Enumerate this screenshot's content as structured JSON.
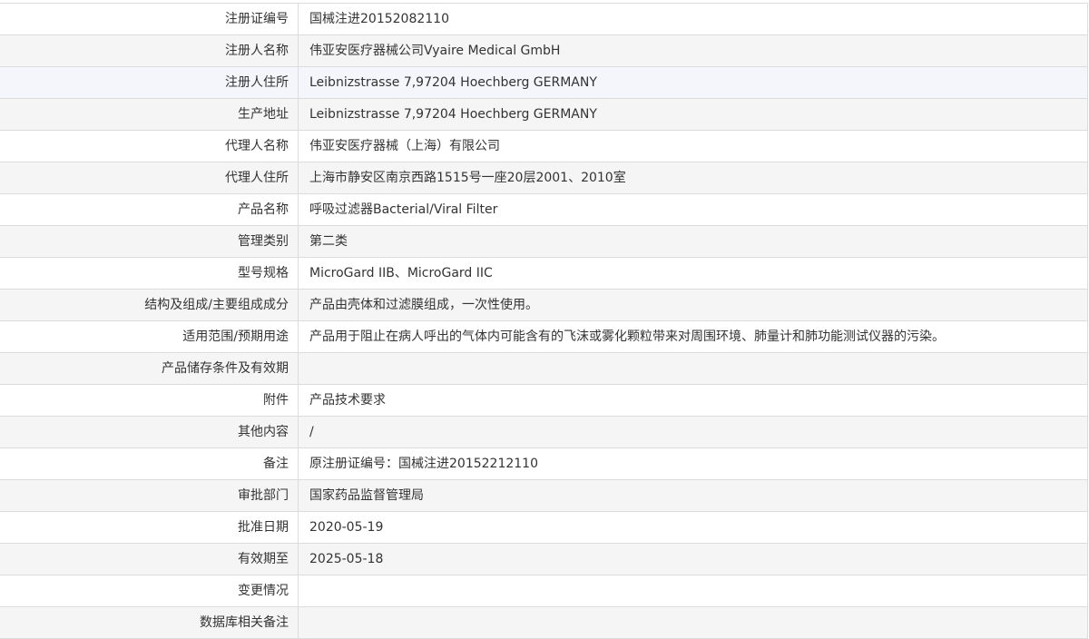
{
  "rows": [
    {
      "label": "注册证编号",
      "value": "国械注进20152082110"
    },
    {
      "label": "注册人名称",
      "value": "伟亚安医疗器械公司Vyaire Medical GmbH"
    },
    {
      "label": "注册人住所",
      "value": "Leibnizstrasse 7,97204 Hoechberg GERMANY"
    },
    {
      "label": "生产地址",
      "value": "Leibnizstrasse 7,97204 Hoechberg GERMANY"
    },
    {
      "label": "代理人名称",
      "value": "伟亚安医疗器械（上海）有限公司"
    },
    {
      "label": "代理人住所",
      "value": "上海市静安区南京西路1515号一座20层2001、2010室"
    },
    {
      "label": "产品名称",
      "value": "呼吸过滤器Bacterial/Viral Filter"
    },
    {
      "label": "管理类别",
      "value": "第二类"
    },
    {
      "label": "型号规格",
      "value": "MicroGard IIB、MicroGard IIC"
    },
    {
      "label": "结构及组成/主要组成成分",
      "value": "产品由壳体和过滤膜组成，一次性使用。"
    },
    {
      "label": "适用范围/预期用途",
      "value": "产品用于阻止在病人呼出的气体内可能含有的飞沫或雾化颗粒带来对周围环境、肺量计和肺功能测试仪器的污染。"
    },
    {
      "label": "产品储存条件及有效期",
      "value": ""
    },
    {
      "label": "附件",
      "value": "产品技术要求"
    },
    {
      "label": "其他内容",
      "value": "/"
    },
    {
      "label": "备注",
      "value": "原注册证编号：国械注进20152212110"
    },
    {
      "label": "审批部门",
      "value": "国家药品监督管理局"
    },
    {
      "label": "批准日期",
      "value": "2020-05-19"
    },
    {
      "label": "有效期至",
      "value": "2025-05-18"
    },
    {
      "label": "变更情况",
      "value": ""
    },
    {
      "label": "数据库相关备注",
      "value": ""
    }
  ]
}
